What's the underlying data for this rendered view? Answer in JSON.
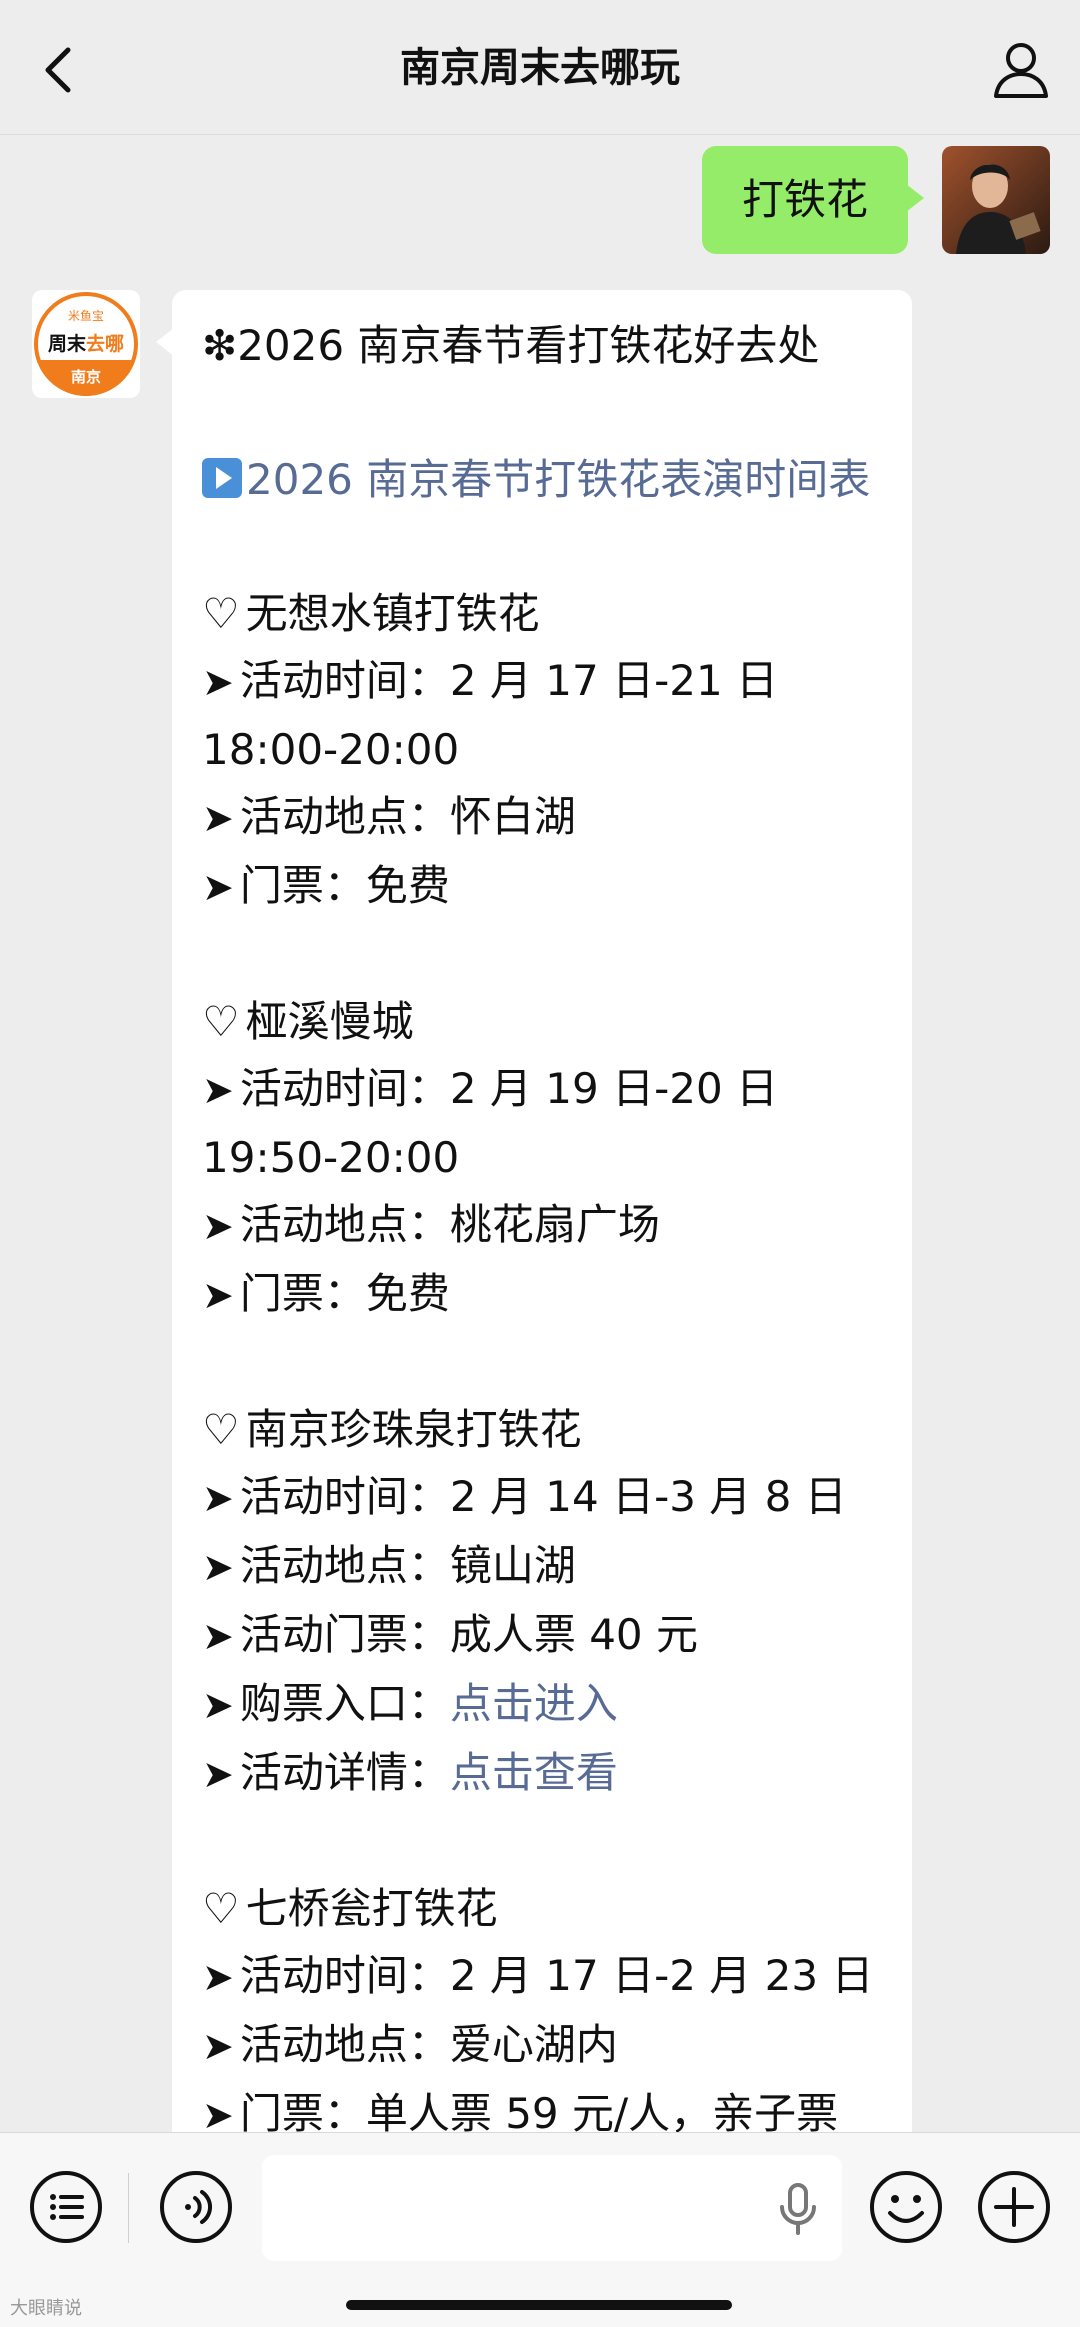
{
  "header": {
    "title": "南京周末去哪玩",
    "back_icon": "chevron-left-icon",
    "profile_icon": "person-icon"
  },
  "chat": {
    "outgoing": {
      "text": "打铁花"
    },
    "bot_avatar": {
      "top_text": "米鱼宝",
      "main_text_black": "周末",
      "main_text_orange": "去哪",
      "bottom_text": "南京"
    },
    "message": {
      "heading": "❇2026 南京春节看打铁花好去处",
      "schedule_link": "2026 南京春节打铁花表演时间表",
      "venues": [
        {
          "name": "无想水镇打铁花",
          "lines": [
            {
              "label": "活动时间：",
              "value": "2 月 17 日-21 日 18:00-20:00"
            },
            {
              "label": "活动地点：",
              "value": "怀白湖"
            },
            {
              "label": "门票：",
              "value": "免费"
            }
          ]
        },
        {
          "name": "桠溪慢城",
          "lines": [
            {
              "label": "活动时间：",
              "value": "2 月 19 日-20 日 19:50-20:00"
            },
            {
              "label": "活动地点：",
              "value": "桃花扇广场"
            },
            {
              "label": "门票：",
              "value": "免费"
            }
          ]
        },
        {
          "name": "南京珍珠泉打铁花",
          "lines": [
            {
              "label": "活动时间：",
              "value": "2 月 14 日-3 月 8 日"
            },
            {
              "label": "活动地点：",
              "value": "镜山湖"
            },
            {
              "label": "活动门票：",
              "value": "成人票 40 元"
            },
            {
              "label": "购票入口：",
              "value": "点击进入",
              "link": true
            },
            {
              "label": "活动详情：",
              "value": "点击查看",
              "link": true
            }
          ]
        },
        {
          "name": "七桥瓮打铁花",
          "lines": [
            {
              "label": "活动时间：",
              "value": "2 月 17 日-2 月 23 日"
            },
            {
              "label": "活动地点：",
              "value": "爱心湖内"
            },
            {
              "label": "门票：",
              "value": "单人票 59 元/人，亲子票"
            }
          ]
        }
      ]
    }
  },
  "inputbar": {
    "menu_icon": "list-menu-icon",
    "voice_icon": "voice-icon",
    "mic_icon": "microphone-icon",
    "emoji_icon": "emoji-icon",
    "plus_icon": "plus-icon"
  },
  "watermark": "大眼睛说",
  "colors": {
    "background": "#ededed",
    "outgoing_bubble": "#95ec69",
    "link": "#576b95",
    "brand_orange": "#f07c1c"
  }
}
